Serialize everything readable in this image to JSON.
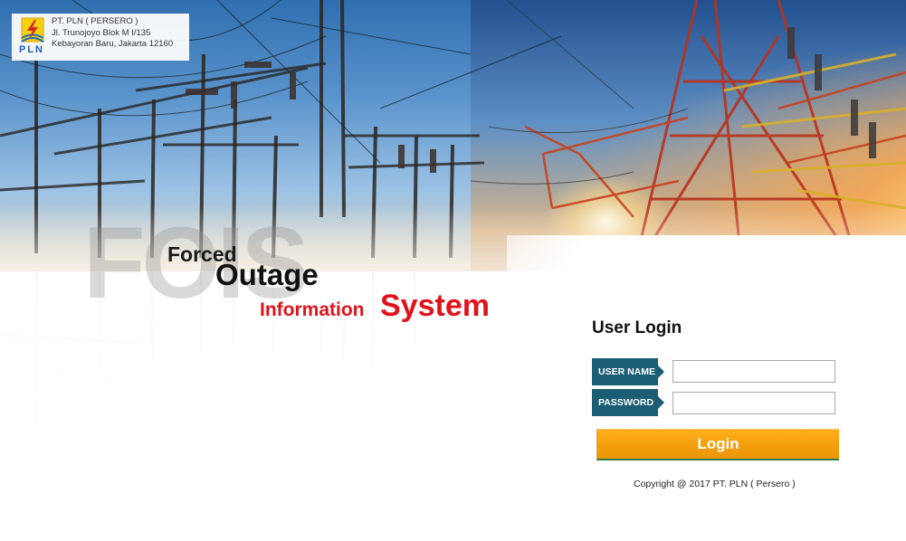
{
  "company": {
    "logo_text": "PLN",
    "name": "PT. PLN ( PERSERO )",
    "address_line1": "Jl. Trunojoyo Blok M I/135",
    "address_line2": "Kebayoran Baru, Jakarta 12160"
  },
  "hero": {
    "watermark": "FOIS",
    "word_forced": "Forced",
    "word_outage": "Outage",
    "word_information": "Information",
    "word_system": "System"
  },
  "login": {
    "title": "User Login",
    "username_label": "USER NAME",
    "username_value": "",
    "password_label": "PASSWORD",
    "password_value": "",
    "button_label": "Login"
  },
  "footer": {
    "copyright": "Copyright @ 2017 PT. PLN ( Persero )"
  },
  "colors": {
    "label_bg": "#1b5e74",
    "button_orange": "#f5a00d",
    "accent_red": "#e0121b"
  }
}
